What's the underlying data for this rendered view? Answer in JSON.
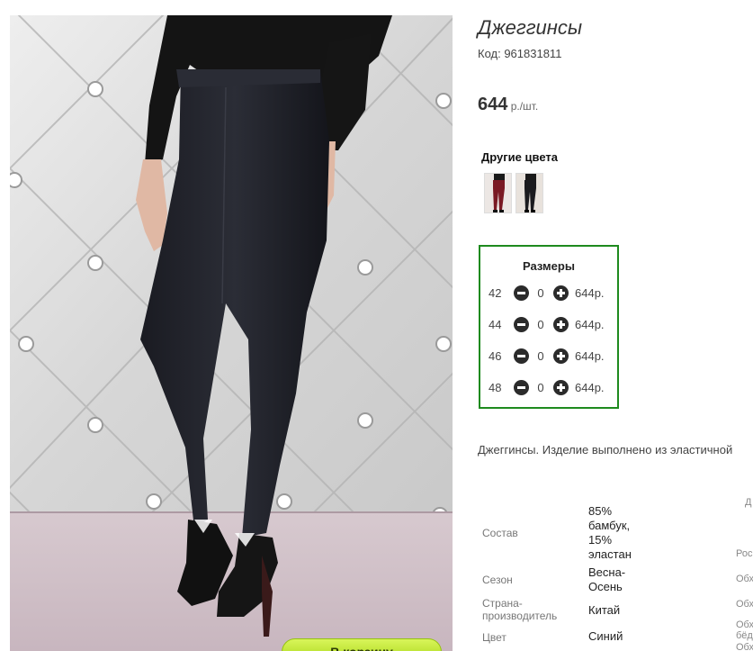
{
  "product": {
    "title": "Джеггинсы",
    "code": "Код: 961831811",
    "price": "644",
    "price_unit": " р./шт.",
    "cart_button": "В корзину"
  },
  "other_colors": {
    "title": "Другие цвета",
    "swatches": [
      {
        "name": "burgundy",
        "color": "#7a1a24"
      },
      {
        "name": "black",
        "color": "#1b1b1f"
      }
    ]
  },
  "sizes": {
    "title": "Размеры",
    "rows": [
      {
        "size": "42",
        "qty": "0",
        "price": "644р."
      },
      {
        "size": "44",
        "qty": "0",
        "price": "644р."
      },
      {
        "size": "46",
        "qty": "0",
        "price": "644р."
      },
      {
        "size": "48",
        "qty": "0",
        "price": "644р."
      }
    ]
  },
  "description": "Джеггинсы. Изделие выполнено из эластичной",
  "specs": [
    {
      "label": "Состав",
      "value": "85% бамбук, 15% эластан"
    },
    {
      "label": "Сезон",
      "value": "Весна-Осень"
    },
    {
      "label": "Страна-производитель",
      "value": "Китай"
    },
    {
      "label": "Цвет",
      "value": "Синий"
    }
  ],
  "right_column": [
    "Д",
    "Рос",
    "Обх",
    "Обх",
    "Обх",
    "бёд",
    "Обх"
  ],
  "colors": {
    "accent_green": "#1e8a1e",
    "button_green": "#a4d414"
  }
}
